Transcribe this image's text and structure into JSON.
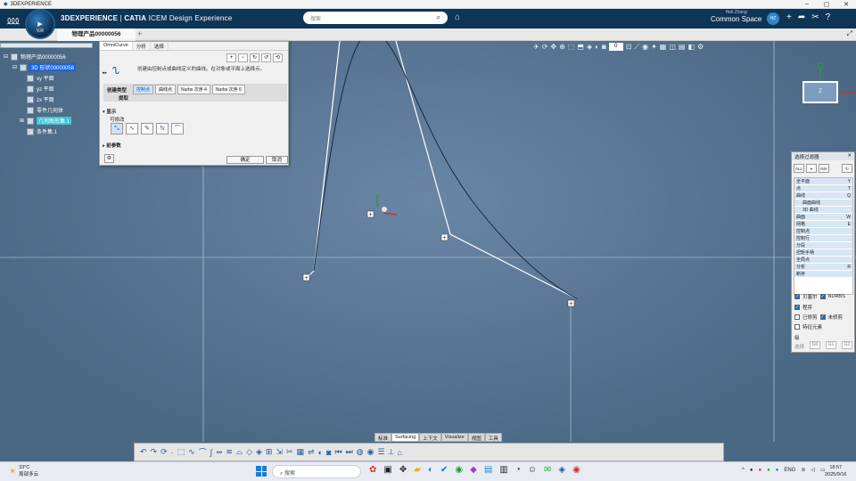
{
  "window": {
    "title": "3DEXPERIENCE"
  },
  "topbar": {
    "brand_prefix": "3DEXPERIENCE",
    "brand_sep": " | ",
    "brand_app": "CATIA",
    "brand_rest": " ICEM Design Experience",
    "compass_version": "V.R",
    "search_placeholder": "搜索",
    "user_name": "Heli Zhang",
    "space": "Common Space",
    "avatar": "HZ"
  },
  "tabs": {
    "active": "物理产品00000056"
  },
  "tree": {
    "root": "物理产品00000056",
    "shape": "3D 形状00000058",
    "items": [
      "xy 平面",
      "yz 平面",
      "zx 平面",
      "零件几何体",
      "几何图形集.1",
      "条件集.1"
    ]
  },
  "dialog": {
    "tabs": [
      "OmniCurve",
      "分析",
      "选择"
    ],
    "description": "创建由控制点或曲线定义的曲线。在对象或平面上选择点。",
    "create_type_label": "创建类型",
    "extract_label": "提取",
    "type_options": [
      "控制点",
      "曲线点",
      "Nurbs 次序 4",
      "Nurbs 次序 6"
    ],
    "active_type": "控制点",
    "display_section": "显示",
    "modifiable_label": "可修改",
    "options_section": "前参数",
    "ok": "确定",
    "cancel": "取消"
  },
  "toolbar_right": {
    "value": "0"
  },
  "filter": {
    "title": "选择过滤器",
    "buttons": [
      "ALL",
      "",
      "INV"
    ],
    "list": [
      {
        "label": "全平面",
        "key": "Y",
        "indent": false
      },
      {
        "label": "点",
        "key": "T",
        "indent": false
      },
      {
        "label": "曲线",
        "key": "Q",
        "indent": false
      },
      {
        "label": "曲面曲线",
        "key": "",
        "indent": true
      },
      {
        "label": "3D 曲线",
        "key": "",
        "indent": true
      },
      {
        "label": "曲面",
        "key": "W",
        "indent": false
      },
      {
        "label": "网格",
        "key": "E",
        "indent": false
      },
      {
        "label": "控制点",
        "key": "",
        "indent": false
      },
      {
        "label": "控制行",
        "key": "",
        "indent": false
      },
      {
        "label": "分段",
        "key": "",
        "indent": false
      },
      {
        "label": "扭矩手柄",
        "key": "",
        "indent": false
      },
      {
        "label": "全局点",
        "key": "",
        "indent": false
      },
      {
        "label": "分析",
        "key": "R",
        "indent": false
      },
      {
        "label": "断序",
        "key": "",
        "indent": false
      }
    ],
    "checks": [
      {
        "label": "贝塞尔",
        "on": true
      },
      {
        "label": "NURBS",
        "on": true
      },
      {
        "label": "程序",
        "on": true
      },
      {
        "label": "已修剪",
        "on": false
      },
      {
        "label": "未修剪",
        "on": true
      },
      {
        "label": "特征元素",
        "on": false
      }
    ],
    "g_label": "级",
    "g_select": "选择",
    "g_buttons": [
      "G0",
      "G1",
      "G2"
    ]
  },
  "section_tabs": [
    "标准",
    "Surfacing",
    "上下文",
    "Visualize",
    "视图",
    "工具"
  ],
  "section_active": "Surfacing",
  "taskbar": {
    "temp": "33°C",
    "weather": "局部多云",
    "search": "搜索",
    "lang": "ENG",
    "time": "18:57",
    "date": "2025/9/16"
  }
}
